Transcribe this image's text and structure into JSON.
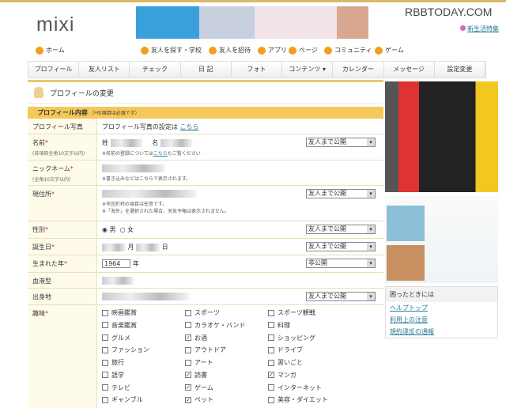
{
  "header": {
    "logo": "mixi",
    "watermark": "RBBTODAY.COM",
    "feature_link": "新生活特集"
  },
  "nav": {
    "home": "ホーム",
    "links": [
      "友人を探す・学校",
      "友人を招待",
      "アプリ",
      "ページ",
      "コミュニティ",
      "ゲーム"
    ]
  },
  "tabs": [
    "プロフィール",
    "友人リスト",
    "チェック",
    "日 記",
    "フォト",
    "コンテンツ ▾",
    "カレンダー",
    "メッセージ",
    "設定変更"
  ],
  "page_title": "プロフィールの変更",
  "section": {
    "title": "プロフィール内容",
    "note": "（*の項目は必須です）"
  },
  "rows": {
    "photo": {
      "label": "プロフィール写真",
      "text": "プロフィール写真の設定は",
      "link": "こちら"
    },
    "name": {
      "label": "名前",
      "sub": "(各項目全角10文字以内)",
      "sei": "姓",
      "mei": "名",
      "note_a": "※名前の登録については",
      "note_link": "こちら",
      "note_b": "もご覧ください",
      "privacy": "友人まで公開"
    },
    "nickname": {
      "label": "ニックネーム",
      "sub": "(全角10文字以内)",
      "note": "※書き込みなどはこちらで表示されます。"
    },
    "address": {
      "label": "現住所",
      "note1": "※市区町村の項目は任意です。",
      "note2": "※「海外」を選択された場合、天気予報は表示されません。",
      "privacy": "友人まで公開"
    },
    "gender": {
      "label": "性別",
      "male": "男",
      "female": "女",
      "selected": "男",
      "privacy": "友人まで公開"
    },
    "birthday": {
      "label": "誕生日",
      "month": "月",
      "day": "日",
      "privacy": "友人まで公開"
    },
    "birthyear": {
      "label": "生まれた年",
      "year": "1964",
      "unit": "年",
      "privacy": "非公開"
    },
    "blood": {
      "label": "血液型"
    },
    "birthplace": {
      "label": "出身地",
      "privacy": "友人まで公開"
    },
    "hobbies": {
      "label": "趣味",
      "items": [
        {
          "t": "映画鑑賞",
          "c": false
        },
        {
          "t": "スポーツ",
          "c": false
        },
        {
          "t": "スポーツ観戦",
          "c": false
        },
        {
          "t": "音楽鑑賞",
          "c": false
        },
        {
          "t": "カラオケ・バンド",
          "c": false
        },
        {
          "t": "料理",
          "c": false
        },
        {
          "t": "グルメ",
          "c": false
        },
        {
          "t": "お酒",
          "c": true
        },
        {
          "t": "ショッピング",
          "c": false
        },
        {
          "t": "ファッション",
          "c": false
        },
        {
          "t": "アウトドア",
          "c": false
        },
        {
          "t": "ドライブ",
          "c": false
        },
        {
          "t": "旅行",
          "c": false
        },
        {
          "t": "アート",
          "c": false
        },
        {
          "t": "習いごと",
          "c": false
        },
        {
          "t": "語学",
          "c": false
        },
        {
          "t": "読書",
          "c": true
        },
        {
          "t": "マンガ",
          "c": true
        },
        {
          "t": "テレビ",
          "c": false
        },
        {
          "t": "ゲーム",
          "c": true
        },
        {
          "t": "インターネット",
          "c": false
        },
        {
          "t": "ギャンブル",
          "c": false
        },
        {
          "t": "ペット",
          "c": true
        },
        {
          "t": "美容・ダイエット",
          "c": false
        }
      ]
    }
  },
  "help": {
    "title": "困ったときには",
    "links": [
      "ヘルプトップ",
      "利用上の注意",
      "規約違反の通報"
    ]
  }
}
